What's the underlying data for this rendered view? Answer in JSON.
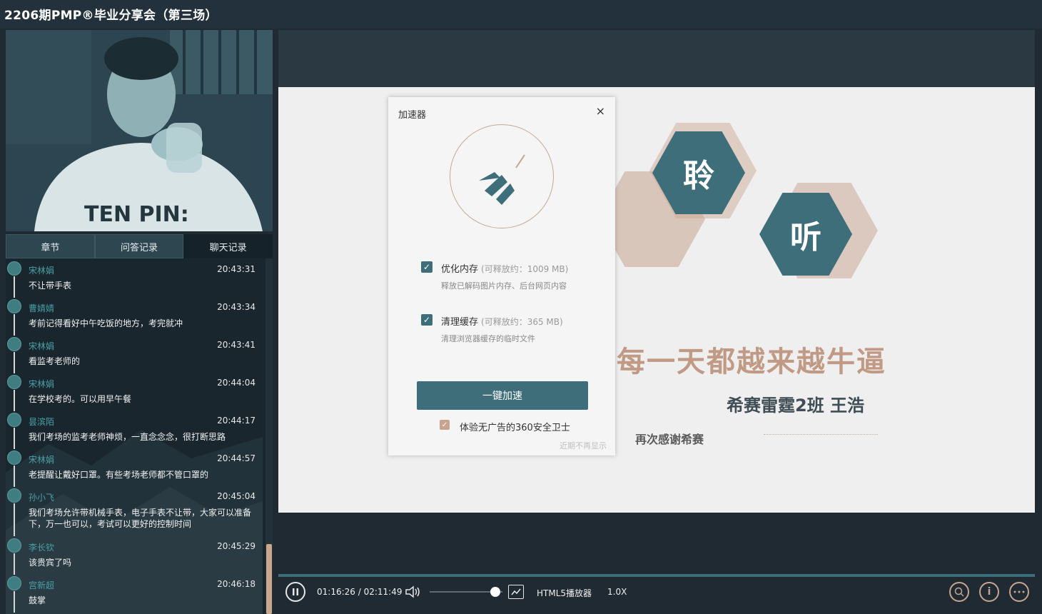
{
  "app": {
    "title": "2206期PMP®毕业分享会（第三场）"
  },
  "tabs": [
    {
      "label": "章节"
    },
    {
      "label": "问答记录"
    },
    {
      "label": "聊天记录"
    }
  ],
  "chat": [
    {
      "name": "宋林娟",
      "time": "20:43:31",
      "text": "不让带手表"
    },
    {
      "name": "曹婧婧",
      "time": "20:43:34",
      "text": "考前记得看好中午吃饭的地方，考完就冲"
    },
    {
      "name": "宋林娟",
      "time": "20:43:41",
      "text": "看监考老师的"
    },
    {
      "name": "宋林娟",
      "time": "20:44:04",
      "text": "在学校考的。可以用早午餐"
    },
    {
      "name": "昙滨陌",
      "time": "20:44:17",
      "text": "我们考场的监考老师神烦，一直念念念，很打断思路"
    },
    {
      "name": "宋林娟",
      "time": "20:44:57",
      "text": "老提醒让戴好口罩。有些考场老师都不管口罩的"
    },
    {
      "name": "孙小飞",
      "time": "20:45:04",
      "text": "我们考场允许带机械手表，电子手表不让带，大家可以准备下，万一也可以，考试可以更好的控制时间"
    },
    {
      "name": "李长钦",
      "time": "20:45:29",
      "text": "该贵宾了吗"
    },
    {
      "name": "宫新超",
      "time": "20:46:18",
      "text": "鼓掌"
    }
  ],
  "slide": {
    "hex1": "聆",
    "hex2": "听",
    "slogan": "每一天都越来越牛逼",
    "author": "希赛雷霆2班 王浩",
    "thanks": "再次感谢希赛"
  },
  "dialog": {
    "title": "加速器",
    "close": "×",
    "options": [
      {
        "label": "优化内存",
        "sub": "(可释放约：1009 MB)",
        "desc": "释放已解码图片内存、后台网页内容"
      },
      {
        "label": "清理缓存",
        "sub": "(可释放约：365 MB)",
        "desc": "清理浏览器缓存的临时文件"
      }
    ],
    "boost_label": "一键加速",
    "promo": "体验无广告的360安全卫士",
    "no_remind": "近期不再显示"
  },
  "player": {
    "time": "01:16:26 / 02:11:49",
    "engine": "HTML5播放器",
    "speed": "1.0X",
    "volume_level": 0.9
  },
  "colors": {
    "accent": "#3e6e79",
    "highlight": "#c7a48f",
    "background": "#1f2a33"
  }
}
